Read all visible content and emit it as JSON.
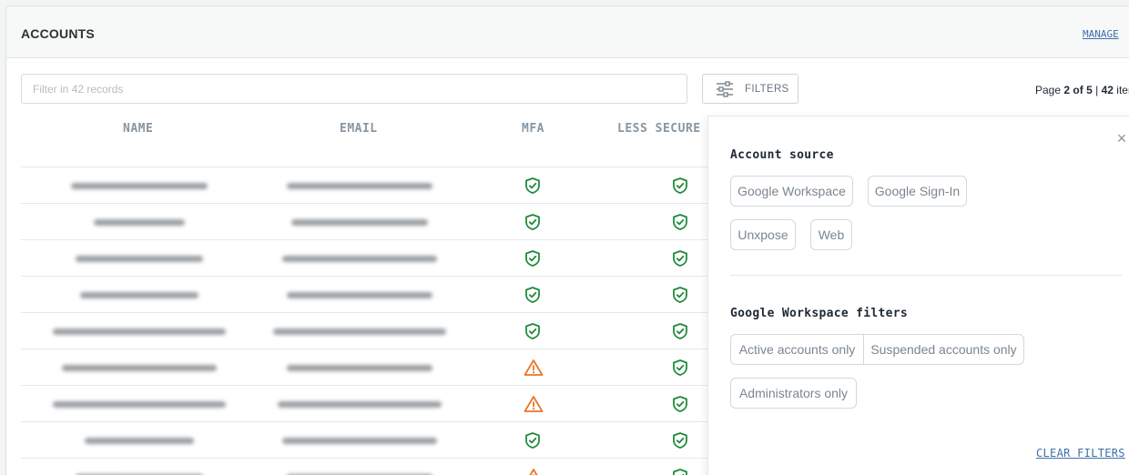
{
  "header": {
    "title": "ACCOUNTS",
    "manage_label": "MANAGE"
  },
  "search": {
    "placeholder": "Filter in 42 records",
    "value": ""
  },
  "filters_button": {
    "label": "FILTERS",
    "icon": "sliders-icon"
  },
  "pagination": {
    "prefix": "Page",
    "current_page": "2",
    "of": "of",
    "total_pages": "5",
    "separator": "|",
    "total_items": "42",
    "items_label": "items"
  },
  "table": {
    "columns": [
      "NAME",
      "EMAIL",
      "MFA",
      "LESS SECURE"
    ],
    "rows": [
      {
        "name": "[blurred]",
        "email": "[blurred]",
        "mfa": "shield-check",
        "less_secure": "shield-check"
      },
      {
        "name": "[blurred]",
        "email": "[blurred]",
        "mfa": "shield-check",
        "less_secure": "shield-check"
      },
      {
        "name": "[blurred]",
        "email": "[blurred]",
        "mfa": "shield-check",
        "less_secure": "shield-check"
      },
      {
        "name": "[blurred]",
        "email": "[blurred]",
        "mfa": "shield-check",
        "less_secure": "shield-check"
      },
      {
        "name": "[blurred]",
        "email": "[blurred]",
        "mfa": "shield-check",
        "less_secure": "shield-check"
      },
      {
        "name": "[blurred]",
        "email": "[blurred]",
        "mfa": "warning",
        "less_secure": "shield-check"
      },
      {
        "name": "[blurred]",
        "email": "[blurred]",
        "mfa": "warning",
        "less_secure": "shield-check"
      },
      {
        "name": "[blurred]",
        "email": "[blurred]",
        "mfa": "shield-check",
        "less_secure": "shield-check"
      },
      {
        "name": "[blurred]",
        "email": "[blurred]",
        "mfa": "warning",
        "less_secure": "shield-check"
      }
    ]
  },
  "filter_panel": {
    "close_symbol": "×",
    "account_source": {
      "title": "Account source",
      "options": [
        "Google Workspace",
        "Google Sign-In",
        "Unxpose",
        "Web"
      ]
    },
    "workspace_filters": {
      "title": "Google Workspace filters",
      "options": [
        "Active accounts only",
        "Suspended accounts only",
        "Administrators only"
      ]
    },
    "clear_label": "CLEAR FILTERS"
  },
  "colors": {
    "ok_green": "#1f8a3b",
    "warn_orange": "#e8762b",
    "link_blue": "#3e6fa8"
  }
}
